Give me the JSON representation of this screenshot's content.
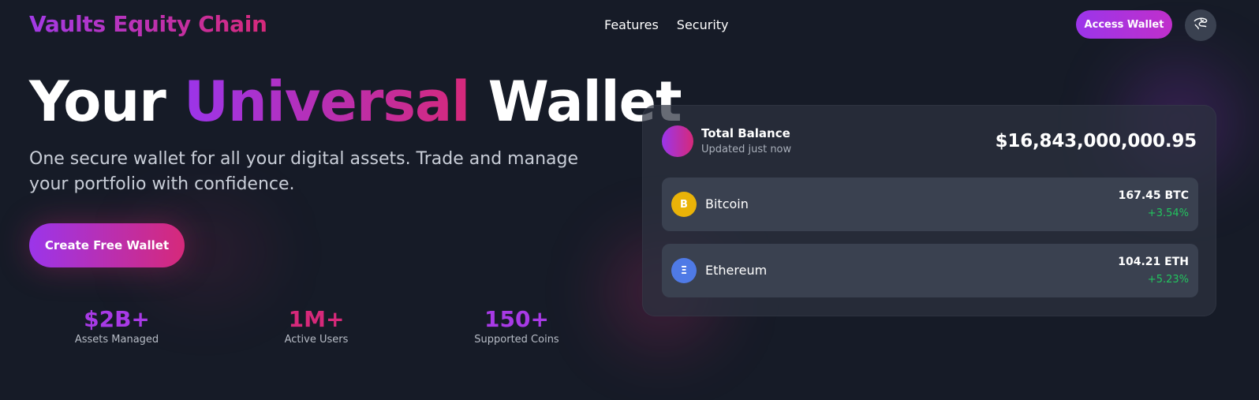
{
  "nav": {
    "logo": "Vaults Equity Chain",
    "links": [
      {
        "label": "Features"
      },
      {
        "label": "Security"
      }
    ],
    "access_button": "Access Wallet",
    "language_icon": "globe-icon"
  },
  "hero": {
    "title_part1": "Your",
    "title_accent": "Universal",
    "title_part2": "Wallet",
    "subtitle": "One secure wallet for all your digital assets. Trade and manage your portfolio with confidence.",
    "cta": "Create Free Wallet"
  },
  "stats": [
    {
      "value": "$2B+",
      "label": "Assets Managed"
    },
    {
      "value": "1M+",
      "label": "Active Users"
    },
    {
      "value": "150+",
      "label": "Supported Coins"
    }
  ],
  "balance_card": {
    "title": "Total Balance",
    "updated": "Updated just now",
    "amount": "$16,843,000,000.95",
    "assets": [
      {
        "name": "Bitcoin",
        "symbol_glyph": "B",
        "amount": "167.45 BTC",
        "change": "+3.54%",
        "icon": "bitcoin-icon"
      },
      {
        "name": "Ethereum",
        "symbol_glyph": "Ξ",
        "amount": "104.21 ETH",
        "change": "+5.23%",
        "icon": "ethereum-icon"
      }
    ]
  },
  "colors": {
    "background": "#161b27",
    "accent_purple": "#9b35ea",
    "accent_pink": "#d6297a",
    "positive_green": "#22c55e",
    "bitcoin": "#eab308",
    "ethereum": "#4f7ae6"
  }
}
